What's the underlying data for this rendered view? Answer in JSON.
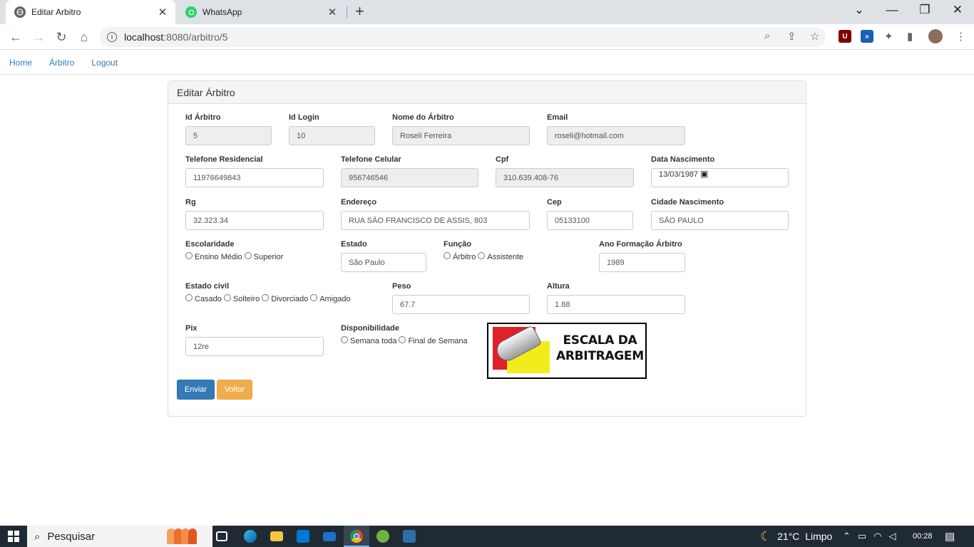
{
  "browser": {
    "tabs": [
      {
        "title": "Editar Arbitro",
        "icon": "globe-icon",
        "active": true
      },
      {
        "title": "WhatsApp",
        "icon": "whatsapp-icon",
        "active": false
      }
    ],
    "url_host": "localhost",
    "url_path": ":8080/arbitro/5"
  },
  "nav": {
    "home": "Home",
    "arbitro": "Árbitro",
    "logout": "Logout"
  },
  "panel": {
    "title": "Editar Árbitro"
  },
  "form": {
    "id_arbitro": {
      "label": "Id Árbitro",
      "value": "5"
    },
    "id_login": {
      "label": "Id Login",
      "value": "10"
    },
    "nome": {
      "label": "Nome do Árbitro",
      "value": "Roseli Ferreira"
    },
    "email": {
      "label": "Email",
      "value": "roseli@hotmail.com"
    },
    "telefone_res": {
      "label": "Telefone Residencial",
      "value": "11976649843"
    },
    "telefone_cel": {
      "label": "Telefone Celular",
      "value": "956746546"
    },
    "cpf": {
      "label": "Cpf",
      "value": "310.639.408-76"
    },
    "data_nasc": {
      "label": "Data Nascimento",
      "value": "13/03/1987"
    },
    "rg": {
      "label": "Rg",
      "value": "32.323.34"
    },
    "endereco": {
      "label": "Endereço",
      "value": "RUA SÃO FRANCISCO DE ASSIS, 803"
    },
    "cep": {
      "label": "Cep",
      "value": "05133100"
    },
    "cidade": {
      "label": "Cidade Nascimento",
      "value": "SÃO PAULO"
    },
    "escolaridade": {
      "label": "Escolaridade",
      "options": [
        "Ensino Médio",
        "Superior"
      ]
    },
    "estado": {
      "label": "Estado",
      "value": "São Paulo"
    },
    "funcao": {
      "label": "Função",
      "options": [
        "Árbitro",
        "Assistente"
      ]
    },
    "ano_formacao": {
      "label": "Ano Formação Árbitro",
      "value": "1989"
    },
    "estado_civil": {
      "label": "Estado civil",
      "options": [
        "Casado",
        "Solteiro",
        "Divorciado",
        "Amigado"
      ]
    },
    "peso": {
      "label": "Peso",
      "value": "67.7"
    },
    "altura": {
      "label": "Altura",
      "value": "1.88"
    },
    "pix": {
      "label": "Pix",
      "value": "12re"
    },
    "disponibilidade": {
      "label": "Disponibilidade",
      "options": [
        "Semana toda",
        "Final de Semana"
      ]
    }
  },
  "logo": {
    "line1": "ESCALA DA",
    "line2": "ARBITRAGEM"
  },
  "buttons": {
    "submit": "Enviar",
    "back": "Voltar"
  },
  "taskbar": {
    "search_placeholder": "Pesquisar",
    "weather": "21°C  Limpo",
    "time": "00:28"
  },
  "colors": {
    "primary": "#337ab7",
    "warning": "#f0ad4e",
    "link": "#337ab7"
  }
}
